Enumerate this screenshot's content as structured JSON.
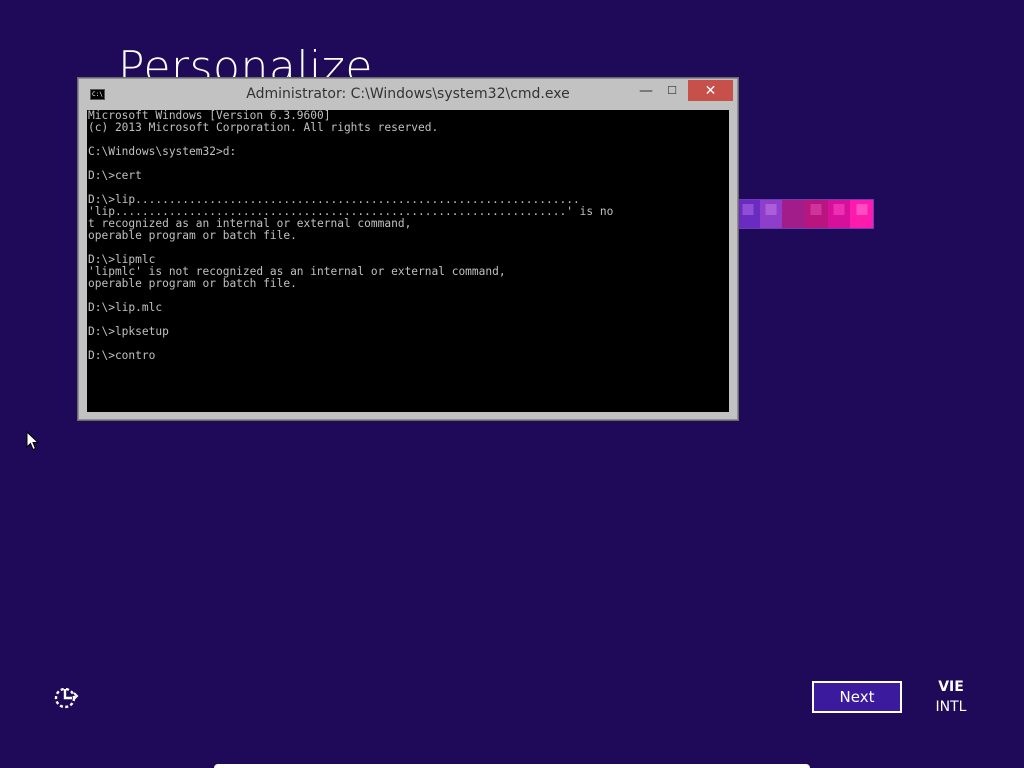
{
  "page": {
    "title": "Personalize"
  },
  "colors": {
    "background": "#1f0a5a",
    "accent_button": "#3b1a9e",
    "close_button": "#c7504a",
    "swatches": [
      "#6a2cc0",
      "#8f3dcb",
      "#a21c8a",
      "#c4137f",
      "#d7109b",
      "#ff1aae"
    ]
  },
  "cmd_window": {
    "title": "Administrator: C:\\Windows\\system32\\cmd.exe",
    "icon_label": "C:\\",
    "minimize_glyph": "—",
    "maximize_glyph": "☐",
    "close_glyph": "✕",
    "lines": [
      "Microsoft Windows [Version 6.3.9600]",
      "(c) 2013 Microsoft Corporation. All rights reserved.",
      "",
      "C:\\Windows\\system32>d:",
      "",
      "D:\\>cert",
      "",
      "D:\\>lip..................................................................",
      "'lip...................................................................' is no",
      "t recognized as an internal or external command,",
      "operable program or batch file.",
      "",
      "D:\\>lipmlc",
      "'lipmlc' is not recognized as an internal or external command,",
      "operable program or batch file.",
      "",
      "D:\\>lip.mlc",
      "",
      "D:\\>lpksetup",
      "",
      "D:\\>contro"
    ]
  },
  "footer": {
    "ease_of_access_icon": "ease-of-access-icon",
    "next_label": "Next",
    "language_code": "VIE",
    "keyboard_layout": "INTL"
  }
}
